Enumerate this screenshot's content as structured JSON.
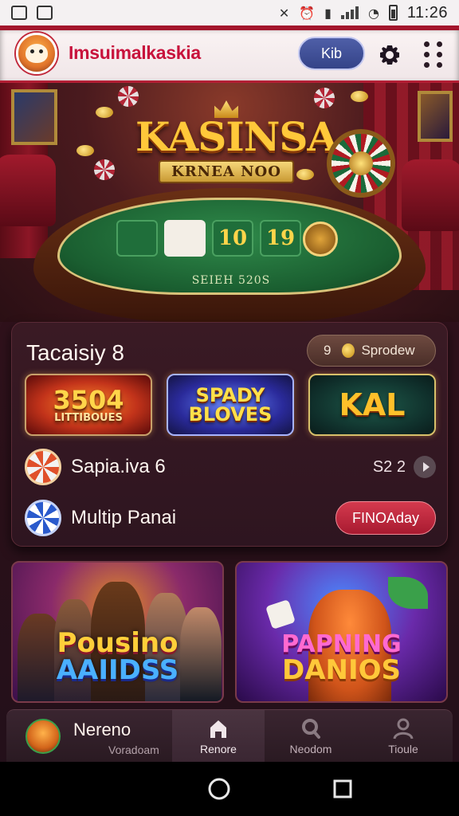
{
  "status_bar": {
    "time": "11:26",
    "left_icons": [
      "image-icon",
      "gallery-icon"
    ],
    "right_icons": [
      "nfc-icon",
      "alarm-icon",
      "vibrate-icon",
      "signal-icon",
      "wifi-icon",
      "battery-icon"
    ]
  },
  "header": {
    "app_title": "Imsuimalkaskia",
    "pill_label": "Kib",
    "logo_icon": "fox-logo-icon",
    "settings_icon": "gear-icon",
    "menu_icon": "more-vert-icon"
  },
  "hero": {
    "title": "KASINSA",
    "subtitle": "KRNEA NOO",
    "table_label": "SEIEH 520S",
    "felt_cards": [
      "",
      "",
      "10",
      "19"
    ]
  },
  "panel": {
    "title": "Tacaisiy 8",
    "promo": {
      "count": "9",
      "label": "Sprodew"
    },
    "tiles": [
      {
        "main": "3504",
        "sub": "LITTIBOUES"
      },
      {
        "main": "SPADY BLOVES",
        "sub": ""
      },
      {
        "main": "KAL",
        "sub": ""
      }
    ],
    "rows": [
      {
        "label": "Sapia.iva 6",
        "value": "S2 2"
      },
      {
        "label": "Multip Panai",
        "button": "FINOAday"
      }
    ]
  },
  "game_cards": [
    {
      "line1": "Pousino",
      "line2": "AAIIDSS"
    },
    {
      "line1": "PAPNING",
      "line2": "DANIOS"
    }
  ],
  "bottom_nav": {
    "profile_name": "Nereno",
    "profile_sub": "Voradoam",
    "tabs": [
      {
        "label": "Renore",
        "icon": "home-icon",
        "active": true
      },
      {
        "label": "Neodom",
        "icon": "search-icon",
        "active": false
      },
      {
        "label": "Tioule",
        "icon": "profile-icon",
        "active": false
      }
    ]
  },
  "colors": {
    "header_accent": "#b31e34",
    "title_red": "#c8123c",
    "cta_red": "#c02a40",
    "gold": "#ffc83a",
    "felt_green": "#1a5e30"
  }
}
